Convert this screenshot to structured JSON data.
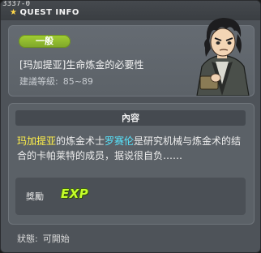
{
  "window": {
    "quest_id": "3337-0",
    "title": "QUEST INFO"
  },
  "quest": {
    "category": "一般",
    "title": "[玛加提亚]生命炼金的必要性",
    "level_label": "建議等級:",
    "level_range": "85~89"
  },
  "content": {
    "header": "內容",
    "segments": [
      {
        "text": "玛加提亚",
        "style": "yellow"
      },
      {
        "text": "的炼金术士",
        "style": "normal"
      },
      {
        "text": "罗赛伦",
        "style": "cyan"
      },
      {
        "text": "是研究机械与炼金术的结合的卡帕莱特的成员，据说很自负……",
        "style": "normal"
      }
    ]
  },
  "reward": {
    "label": "獎勵",
    "exp_icon_text": "EXP"
  },
  "status": {
    "label": "狀態:",
    "value": "可開始"
  },
  "colors": {
    "highlight_yellow": "#fff04a",
    "highlight_cyan": "#58e6ff",
    "category_badge": "#8fbd2d",
    "exp_icon": "#c6ff2a"
  },
  "icons": {
    "title_star": "star-icon",
    "npc": "npc-portrait",
    "exp": "exp-icon"
  }
}
